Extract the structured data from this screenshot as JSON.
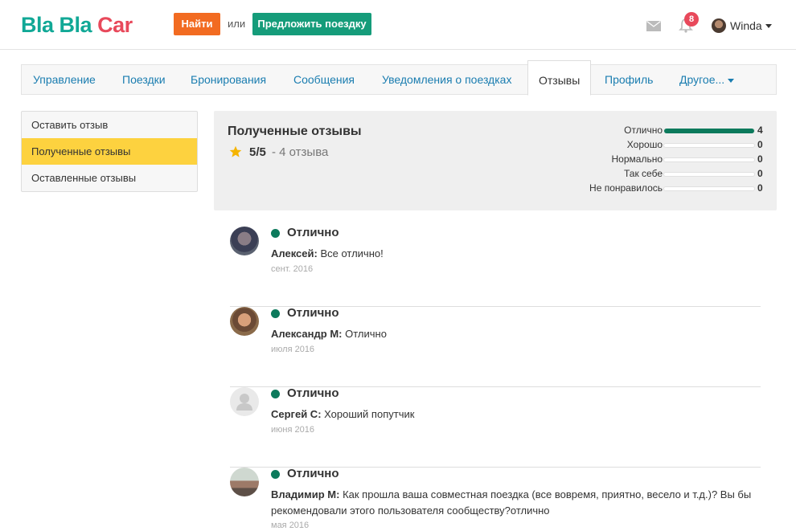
{
  "header": {
    "logo_bla1": "Bla",
    "logo_bla2": "Bla",
    "logo_car": "Car",
    "find_label": "Найти",
    "or_label": "или",
    "offer_label": "Предложить поездку",
    "notification_count": "8",
    "user_name": "Winda",
    "brand_colors": {
      "teal": "#11a896",
      "red": "#e8495b",
      "orange": "#f26b21",
      "green": "#159c7a"
    }
  },
  "tabs": [
    {
      "label": "Управление"
    },
    {
      "label": "Поездки"
    },
    {
      "label": "Бронирования"
    },
    {
      "label": "Сообщения"
    },
    {
      "label": "Уведомления о поездках"
    },
    {
      "label": "Отзывы",
      "active": true
    },
    {
      "label": "Профиль"
    },
    {
      "label": "Другое..."
    }
  ],
  "side_menu": [
    {
      "label": "Оставить отзыв"
    },
    {
      "label": "Полученные отзывы",
      "active": true
    },
    {
      "label": "Оставленные отзывы"
    }
  ],
  "summary": {
    "title": "Полученные отзывы",
    "score": "5/5",
    "count_text": "- 4 отзыва",
    "ratings": [
      {
        "label": "Отлично",
        "count": "4",
        "fraction": 1.0
      },
      {
        "label": "Хорошо",
        "count": "0",
        "fraction": 0
      },
      {
        "label": "Нормально",
        "count": "0",
        "fraction": 0
      },
      {
        "label": "Так себе",
        "count": "0",
        "fraction": 0
      },
      {
        "label": "Не понравилось",
        "count": "0",
        "fraction": 0
      }
    ]
  },
  "reviews": [
    {
      "rating": "Отлично",
      "author": "Алексей:",
      "text": "Все отлично!",
      "date": "сент. 2016",
      "avatar": "photo-dark"
    },
    {
      "rating": "Отлично",
      "author": "Александр М:",
      "text": "Отлично",
      "date": "июля 2016",
      "avatar": "photo-warm"
    },
    {
      "rating": "Отлично",
      "author": "Сергей С:",
      "text": "Хороший попутчик",
      "date": "июня 2016",
      "avatar": "default-user-icon"
    },
    {
      "rating": "Отлично",
      "author": "Владимир М:",
      "text": "Как прошла ваша совместная поездка (все вовремя, приятно, весело и т.д.)? Вы бы рекомендовали этого пользователя сообществу?отлично",
      "date": "мая 2016",
      "avatar": "photo-outdoor"
    }
  ]
}
